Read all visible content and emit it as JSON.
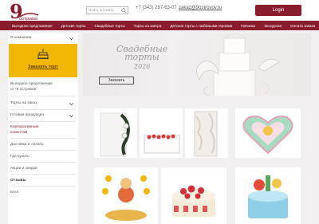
{
  "header": {
    "logo_text": "9 островов",
    "search_placeholder": "Поиск по сайту",
    "phone": "+7 (343) 287-63-07",
    "email": "zakaz@9ostrovov.ru",
    "login_label": "Login"
  },
  "nav": {
    "items": [
      "Выгодное предложение",
      "Детские торты",
      "Свадебные торты",
      "Торты на завтра",
      "Детские торты с любимыми героями",
      "Начинки",
      "Экскурсии",
      "Оплата заказа"
    ]
  },
  "sidebar": {
    "about": "О компании",
    "promo_link": "Заказать торт",
    "items": [
      "Выгодное предложение",
      "от \"9 островов\"",
      "Торты на заказ",
      "Готовая продукция",
      "Корпоративным",
      "клиентам",
      "Доставка и оплата",
      "Где купить",
      "Акции и скидки",
      "Отзывы",
      "Блог"
    ]
  },
  "banner": {
    "title_line1": "Свадебные",
    "title_line2": "торты",
    "year": "2026",
    "button": "Заказать"
  },
  "colors": {
    "brand": "#8a1d2d",
    "accent": "#f2b705",
    "background": "#f1efef"
  }
}
